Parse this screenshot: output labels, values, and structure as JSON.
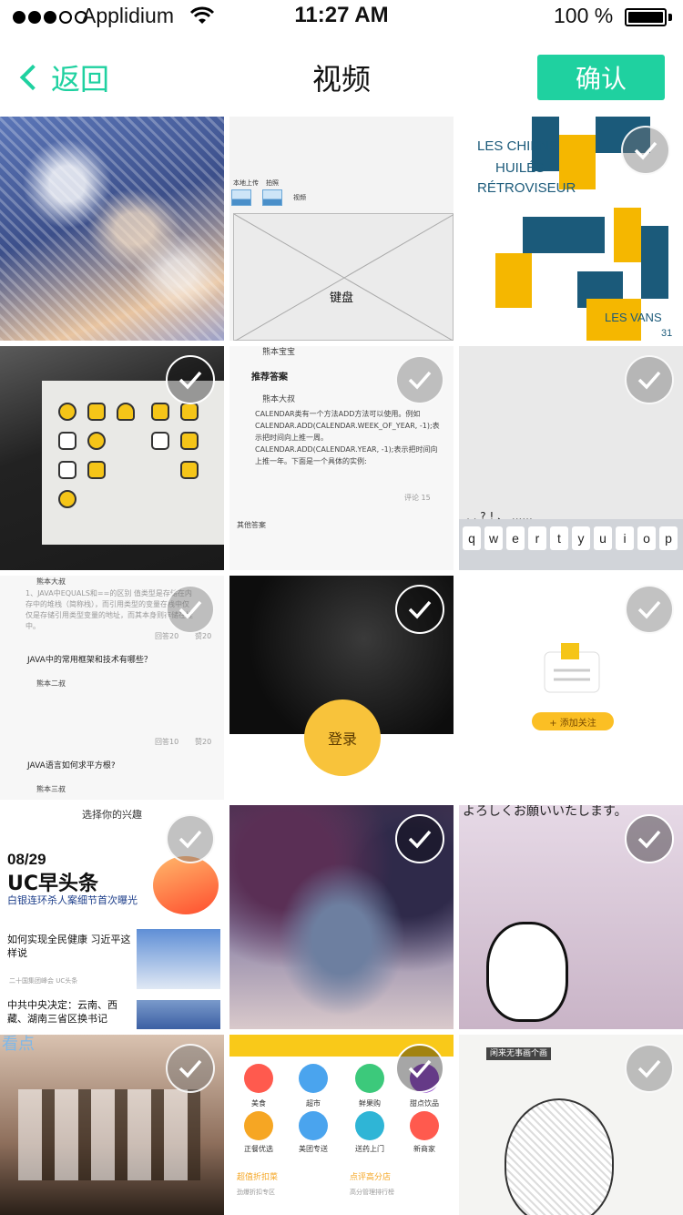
{
  "status_bar": {
    "carrier": "Applidium",
    "time": "11:27 AM",
    "battery": "100 %"
  },
  "nav": {
    "back_label": "返回",
    "title": "视频",
    "confirm_label": "确认"
  },
  "accent_color": "#1fd1a0",
  "grid": {
    "cells": [
      {
        "id": "snow-trees",
        "selected": false,
        "show_check": false
      },
      {
        "id": "wireframe",
        "selected": false,
        "show_check": false
      },
      {
        "id": "jazz-poster",
        "selected": false,
        "show_check": true
      },
      {
        "id": "icon-screen",
        "selected": true,
        "show_check": true
      },
      {
        "id": "qa-calendar",
        "selected": false,
        "show_check": true
      },
      {
        "id": "keyboard",
        "selected": false,
        "show_check": true
      },
      {
        "id": "qa-java",
        "selected": false,
        "show_check": true
      },
      {
        "id": "dark-login",
        "selected": true,
        "show_check": true
      },
      {
        "id": "add-follow",
        "selected": false,
        "show_check": true
      },
      {
        "id": "uc-news",
        "selected": false,
        "show_check": true
      },
      {
        "id": "blurred-photo",
        "selected": true,
        "show_check": true
      },
      {
        "id": "manga",
        "selected": true,
        "show_check": true
      },
      {
        "id": "concert",
        "selected": false,
        "show_check": true
      },
      {
        "id": "meituan",
        "selected": true,
        "show_check": true
      },
      {
        "id": "sketch",
        "selected": false,
        "show_check": true
      }
    ],
    "wireframe": {
      "label1": "本地上传",
      "label2": "拍照",
      "label3": "视频",
      "keyboard": "键盘"
    },
    "poster": {
      "line1": "LES CHIENS",
      "line2": "HUILÉS",
      "line3": "RÉTROVISEUR",
      "line4": "LES VANS",
      "num": "31"
    },
    "qa_calendar": {
      "user": "熊本宝宝",
      "heading": "推荐答案",
      "answerer": "熊本大叔",
      "body": "CALENDAR类有一个方法ADD方法可以使用。例如CALENDAR.ADD(CALENDAR.WEEK_OF_YEAR, -1);表示把时间向上推一周。CALENDAR.ADD(CALENDAR.YEAR, -1);表示把时间向上推一年。下面是一个具体的实例:",
      "comments": "评论 15",
      "other": "其他答案"
    },
    "keyboard_keys": [
      "q",
      "w",
      "e",
      "r",
      "t",
      "y",
      "u",
      "i",
      "o",
      "p"
    ],
    "keyboard_punct": ",  .  ?  !  、  ......",
    "qa_java": {
      "top_user": "熊本大叔",
      "body1": "1、JAVA中EQUALS和==的区别 值类型是存储在内存中的堆栈（简称栈），而引用类型的变量在栈中仅仅是存储引用类型变量的地址，而其本身则存储在堆中。",
      "reply1": "回答20",
      "like1": "赞20",
      "q2": "JAVA中的常用框架和技术有哪些？",
      "user2": "熊本二叔",
      "reply2": "回答10",
      "like2": "赞20",
      "q3": "JAVA语言如何求平方根?",
      "user3": "熊本三叔"
    },
    "login_label": "登录",
    "follow_label": "+ 添加关注",
    "uc_news": {
      "top": "选择你的兴趣",
      "date": "08/29",
      "title": "UC早头条",
      "sub": "白银连环杀人案细节首次曝光",
      "headline1": "如何实现全民健康 习近平这样说",
      "meta1": "二十国集团峰会  UC头条",
      "headline2": "中共中央决定：云南、西藏、湖南三省区换书记"
    },
    "manga_text": "よろしくお願いいたします。",
    "meituan": {
      "items": [
        "美食",
        "超市",
        "鲜果购",
        "甜点饮品",
        "正餐优选",
        "美团专送",
        "送药上门",
        "新商家"
      ],
      "promo1": "超值折扣菜",
      "promo1_sub": "劲爆折扣专区",
      "promo2": "点评高分店",
      "promo2_sub": "高分管理排行榜"
    },
    "sketch_label": "闲来无事画个画",
    "concert_brand": "看点"
  }
}
